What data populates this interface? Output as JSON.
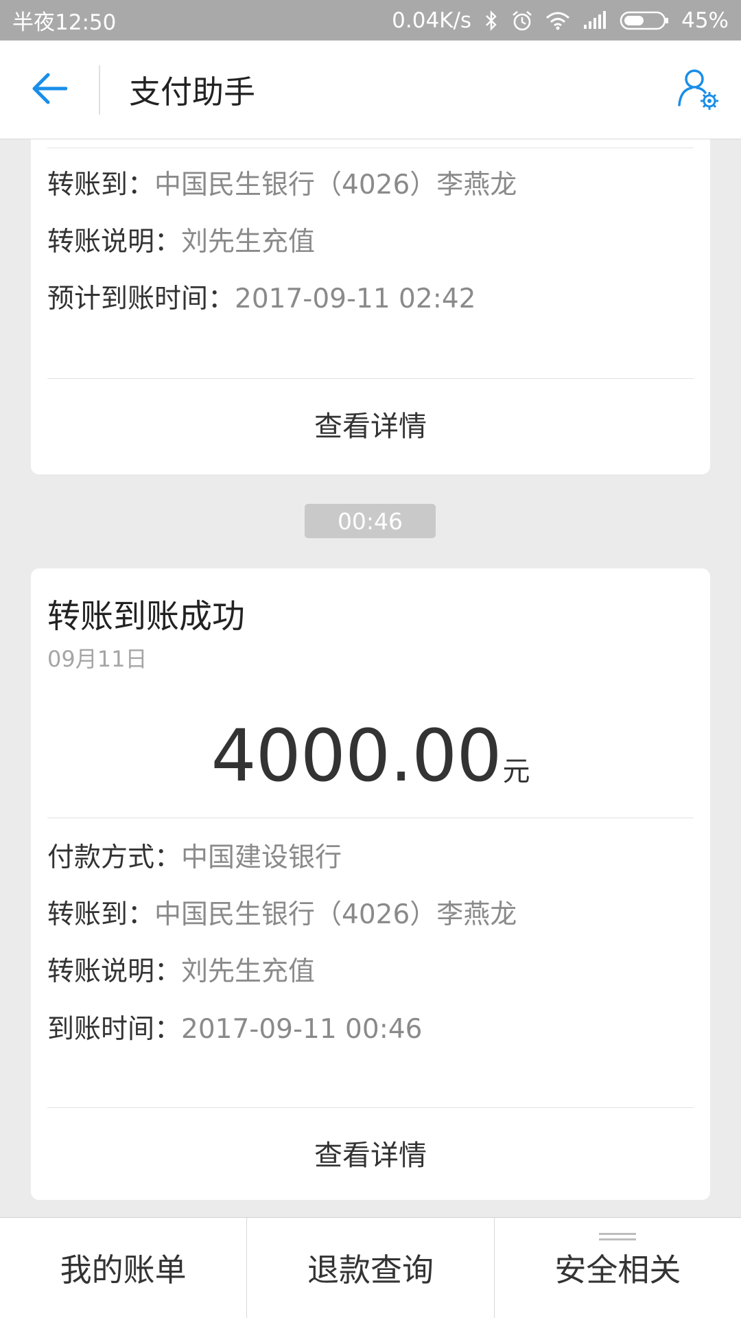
{
  "status_bar": {
    "time": "半夜12:50",
    "speed": "0.04K/s",
    "battery": "45%",
    "icons": [
      "bluetooth-icon",
      "alarm-icon",
      "wifi-icon",
      "signal-icon",
      "battery-icon"
    ]
  },
  "nav": {
    "title": "支付助手",
    "back_icon": "back-arrow-icon",
    "settings_icon": "user-settings-icon",
    "accent_color": "#1a8ee8"
  },
  "card1": {
    "rows": [
      {
        "key": "转账到：",
        "value": "中国民生银行（4026）李燕龙"
      },
      {
        "key": "转账说明：",
        "value": "刘先生充值"
      },
      {
        "key": "预计到账时间：",
        "value": "2017-09-11 02:42"
      }
    ],
    "detail_label": "查看详情"
  },
  "time_pill": "00:46",
  "card2": {
    "title": "转账到账成功",
    "date": "09月11日",
    "amount": "4000.00",
    "unit": "元",
    "rows": [
      {
        "key": "付款方式：",
        "value": "中国建设银行"
      },
      {
        "key": "转账到：",
        "value": "中国民生银行（4026）李燕龙"
      },
      {
        "key": "转账说明：",
        "value": "刘先生充值"
      },
      {
        "key": "到账时间：",
        "value": "2017-09-11 00:46"
      }
    ],
    "detail_label": "查看详情"
  },
  "tabs": [
    {
      "label": "我的账单"
    },
    {
      "label": "退款查询"
    },
    {
      "label": "安全相关"
    }
  ]
}
